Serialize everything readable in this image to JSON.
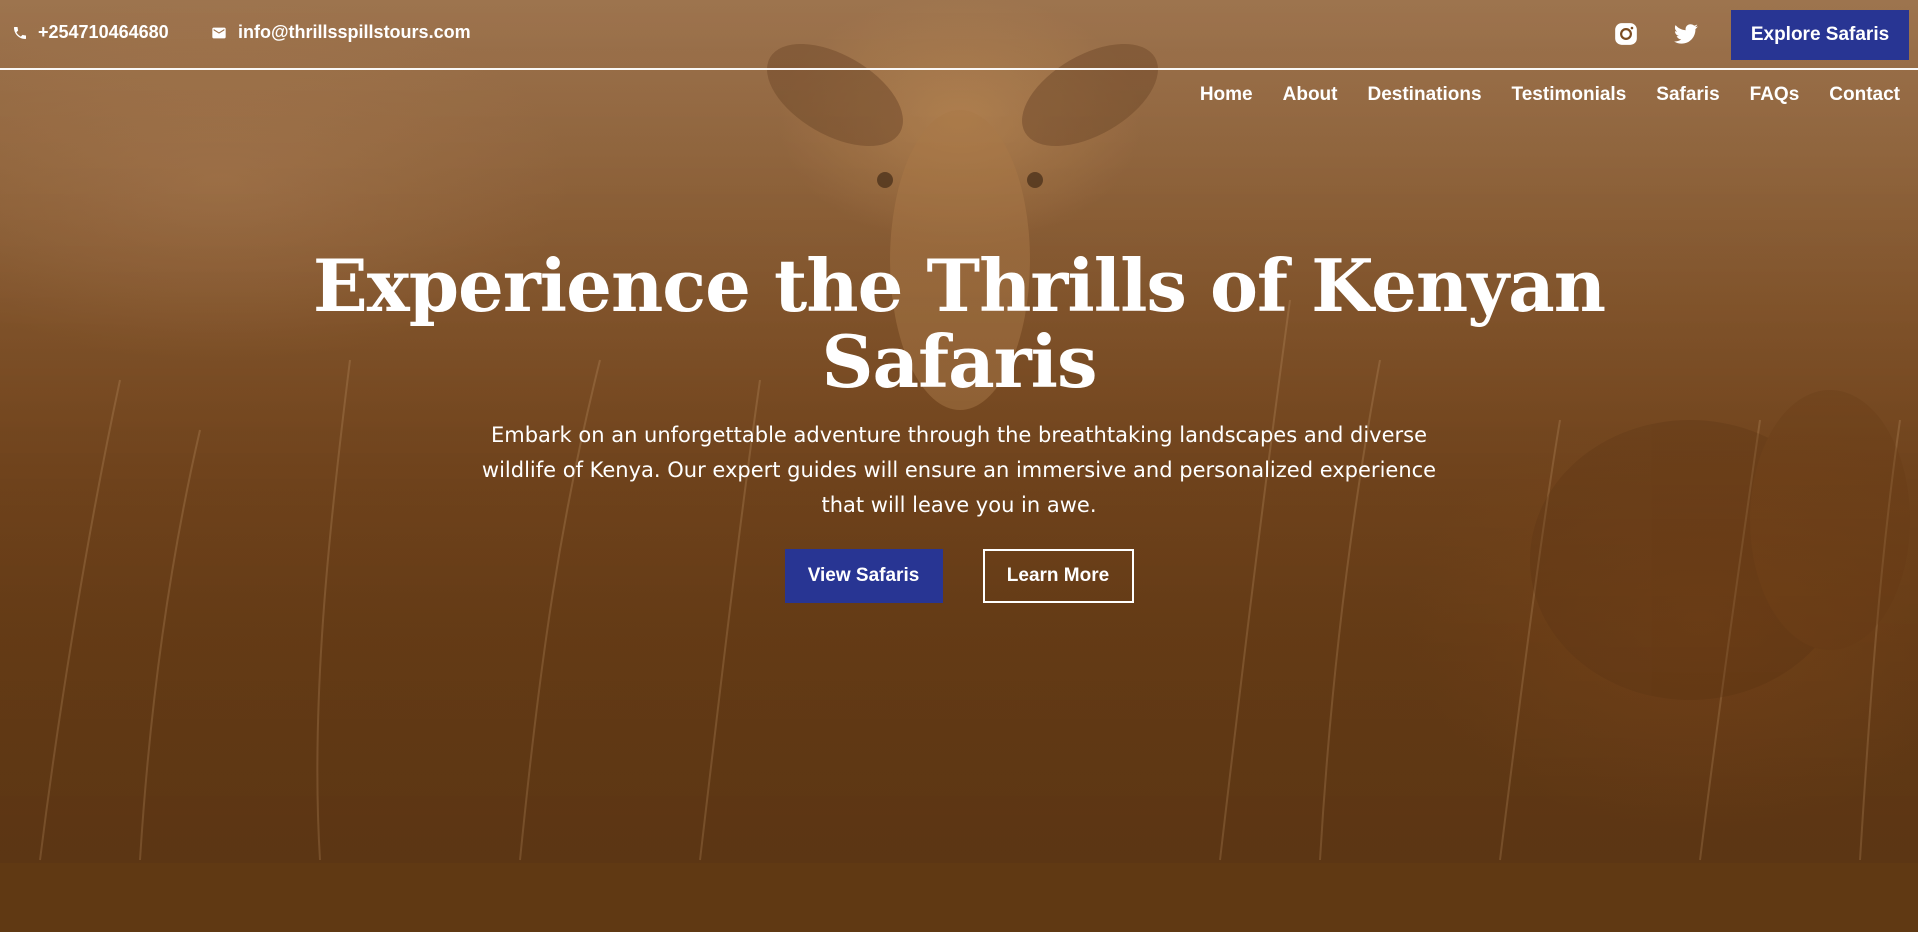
{
  "topbar": {
    "phone": {
      "icon": "phone-icon",
      "text": "+254710464680"
    },
    "email": {
      "icon": "mail-icon",
      "text": "info@thrillsspillstours.com"
    },
    "social": [
      {
        "name": "instagram-icon"
      },
      {
        "name": "twitter-icon"
      }
    ],
    "cta_label": "Explore Safaris"
  },
  "nav": {
    "items": [
      {
        "label": "Home"
      },
      {
        "label": "About"
      },
      {
        "label": "Destinations"
      },
      {
        "label": "Testimonials"
      },
      {
        "label": "Safaris"
      },
      {
        "label": "FAQs"
      },
      {
        "label": "Contact"
      }
    ]
  },
  "hero": {
    "title_line1": "Experience the Thrills of Kenyan",
    "title_line2": "Safaris",
    "description": "Embark on an unforgettable adventure through the breathtaking landscapes and diverse wildlife of Kenya. Our expert guides will ensure an immersive and personalized experience that will leave you in awe.",
    "primary_button": "View Safaris",
    "secondary_button": "Learn More"
  },
  "colors": {
    "accent": "#283593",
    "bottom_band": "#603913",
    "text": "#ffffff"
  }
}
